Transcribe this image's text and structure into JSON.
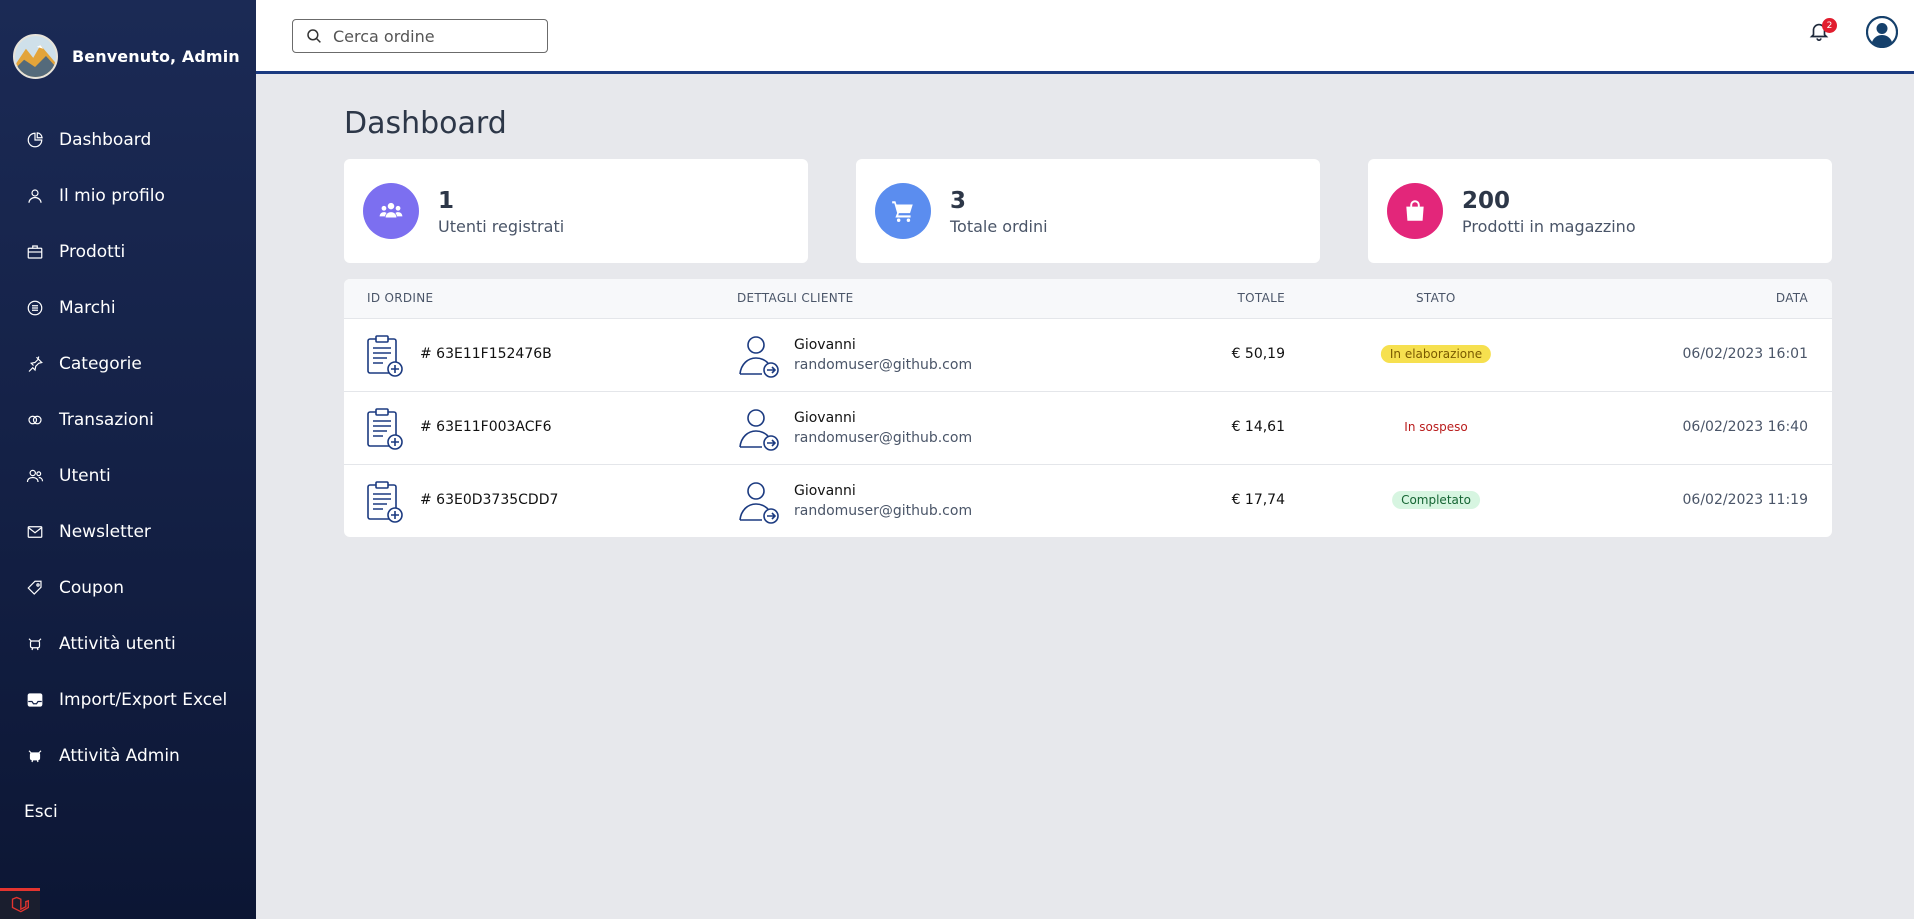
{
  "sidebar": {
    "welcome": "Benvenuto, Admin",
    "items": [
      {
        "label": "Dashboard",
        "icon": "pie-chart-icon"
      },
      {
        "label": "Il mio profilo",
        "icon": "user-icon"
      },
      {
        "label": "Prodotti",
        "icon": "briefcase-icon"
      },
      {
        "label": "Marchi",
        "icon": "list-circle-icon"
      },
      {
        "label": "Categorie",
        "icon": "pin-icon"
      },
      {
        "label": "Transazioni",
        "icon": "transactions-icon"
      },
      {
        "label": "Utenti",
        "icon": "users-icon"
      },
      {
        "label": "Newsletter",
        "icon": "mail-icon"
      },
      {
        "label": "Coupon",
        "icon": "tag-icon"
      },
      {
        "label": "Attività utenti",
        "icon": "activity-icon"
      },
      {
        "label": "Import/Export Excel",
        "icon": "inbox-icon"
      },
      {
        "label": "Attività Admin",
        "icon": "admin-activity-icon"
      }
    ],
    "logout": "Esci"
  },
  "topbar": {
    "search_placeholder": "Cerca ordine",
    "notification_count": "2"
  },
  "page_title": "Dashboard",
  "stats": [
    {
      "value": "1",
      "label": "Utenti registrati",
      "color": "#7c6ff0",
      "icon": "users-group-icon"
    },
    {
      "value": "3",
      "label": "Totale ordini",
      "color": "#5b8def",
      "icon": "cart-icon"
    },
    {
      "value": "200",
      "label": "Prodotti in magazzino",
      "color": "#e3267a",
      "icon": "shopping-bag-icon"
    }
  ],
  "orders": {
    "headers": {
      "id": "ID ORDINE",
      "customer": "DETTAGLI CLIENTE",
      "total": "TOTALE",
      "status": "STATO",
      "date": "DATA"
    },
    "rows": [
      {
        "id": "# 63E11F152476B",
        "name": "Giovanni",
        "email": "randomuser@github.com",
        "total": "€ 50,19",
        "status": "In elaborazione",
        "date": "06/02/2023 16:01"
      },
      {
        "id": "# 63E11F003ACF6",
        "name": "Giovanni",
        "email": "randomuser@github.com",
        "total": "€ 14,61",
        "status": "In sospeso",
        "date": "06/02/2023 16:40"
      },
      {
        "id": "# 63E0D3735CDD7",
        "name": "Giovanni",
        "email": "randomuser@github.com",
        "total": "€ 17,74",
        "status": "Completato",
        "date": "06/02/2023 11:19"
      }
    ]
  }
}
